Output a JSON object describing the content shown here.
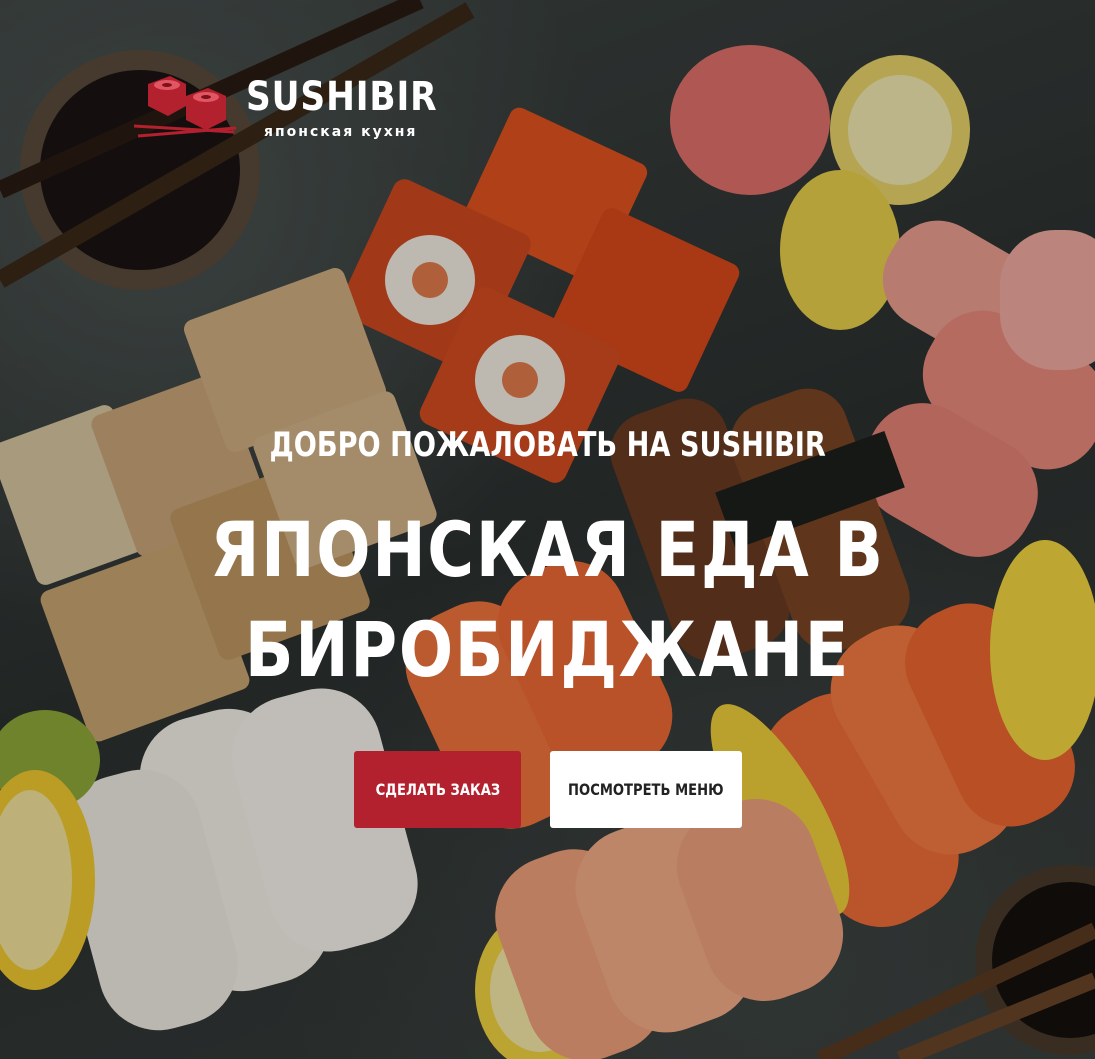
{
  "brand": {
    "name": "SUSHIBIR",
    "tagline": "японская кухня",
    "logo_icon": "sushi-rolls-chopsticks-logo",
    "accent_color": "#b3202e"
  },
  "hero": {
    "welcome": "ДОБРО ПОЖАЛОВАТЬ НА SUSHIBIR",
    "headline_line1": "ЯПОНСКАЯ ЕДА В",
    "headline_line2": "БИРОБИДЖАНЕ",
    "background": "sushi-platter-photo"
  },
  "buttons": {
    "order_label": "СДЕЛАТЬ ЗАКАЗ",
    "menu_label": "ПОСМОТРЕТЬ МЕНЮ"
  }
}
